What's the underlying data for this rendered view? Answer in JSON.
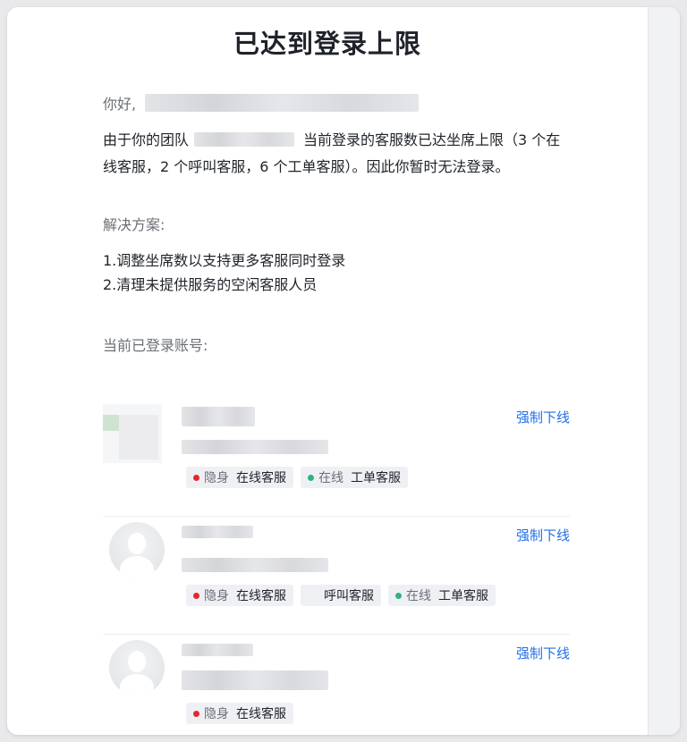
{
  "dialog": {
    "title": "已达到登录上限",
    "greeting": "你好,",
    "message": "由于你的团队 当前登录的客服数已达坐席上限（3个在线客服，2 个呼叫客服，6 个工单客服）。因此你暂时无法登录。",
    "message_prefix": "由于你的团队",
    "message_suffix": "当前登录的客服数已达坐席上限（3 个在线客服，2 个呼叫客服，6 个工单客服）。因此你暂时无法登录。",
    "solution_title": "解决方案:",
    "solutions": [
      "1.调整坐席数以支持更多客服同时登录",
      "2.清理未提供服务的空闲客服人员"
    ],
    "accounts_title": "当前已登录账号:",
    "kick_label": "强制下线",
    "colors": {
      "hidden": "#e8262d",
      "online": "#2fb37e",
      "link": "#1f6feb"
    },
    "accounts": [
      {
        "tags": [
          {
            "status": "隐身",
            "status_color": "hidden",
            "role": "在线客服"
          },
          {
            "status": "在线",
            "status_color": "online",
            "role": "工单客服"
          }
        ]
      },
      {
        "tags": [
          {
            "status": "隐身",
            "status_color": "hidden",
            "role": "在线客服"
          },
          {
            "status": "",
            "status_color": "",
            "role": "呼叫客服"
          },
          {
            "status": "在线",
            "status_color": "online",
            "role": "工单客服"
          }
        ]
      },
      {
        "tags": [
          {
            "status": "隐身",
            "status_color": "hidden",
            "role": "在线客服"
          }
        ]
      }
    ]
  }
}
